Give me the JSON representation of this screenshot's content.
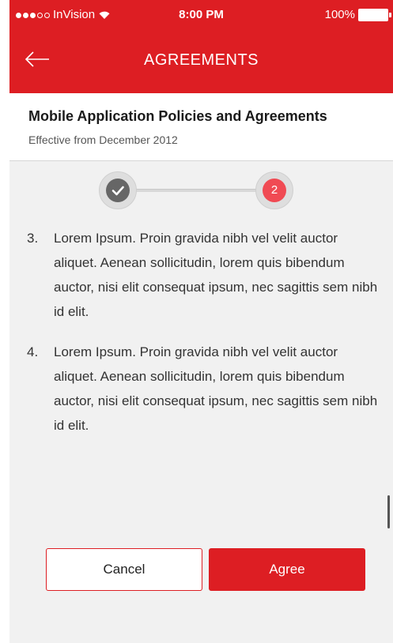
{
  "status_bar": {
    "carrier": "InVision",
    "time": "8:00 PM",
    "battery": "100%"
  },
  "header": {
    "title": "AGREEMENTS",
    "back_icon": "arrow-left-icon"
  },
  "document": {
    "title": "Mobile Application Policies and Agreements",
    "subtitle": "Effective from December 2012"
  },
  "stepper": {
    "steps": [
      {
        "state": "complete",
        "icon": "checkmark-icon"
      },
      {
        "state": "current",
        "label": "2"
      }
    ]
  },
  "terms": [
    {
      "number": "3.",
      "text": "Lorem Ipsum. Proin gravida nibh vel velit auctor aliquet. Aenean sollicitudin, lorem quis bibendum auctor, nisi elit consequat ipsum, nec sagittis sem nibh id elit."
    },
    {
      "number": "4.",
      "text": "Lorem Ipsum. Proin gravida nibh vel velit auctor aliquet. Aenean sollicitudin, lorem quis bibendum auctor, nisi elit consequat ipsum, nec sagittis sem nibh id elit."
    }
  ],
  "actions": {
    "cancel_label": "Cancel",
    "agree_label": "Agree"
  },
  "colors": {
    "brand_red": "#dd1e23",
    "step_active": "#f04a53",
    "step_done": "#666666",
    "background": "#f1f1f1"
  }
}
